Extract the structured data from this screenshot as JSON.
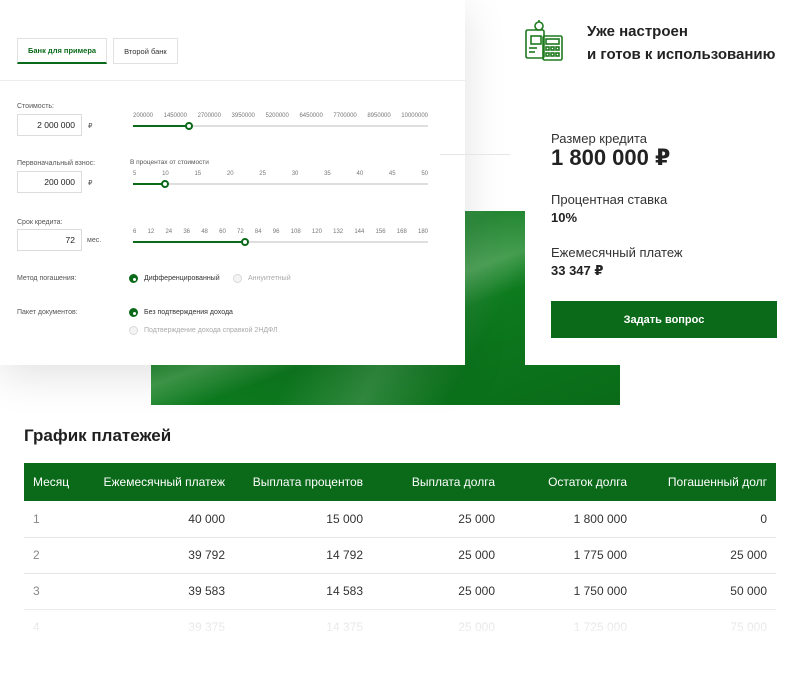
{
  "calculator": {
    "tabs": [
      "Банк для примера",
      "Второй банк"
    ],
    "cost": {
      "label": "Стоимость:",
      "value": "2 000 000",
      "unit": "₽",
      "ticks": [
        "200000",
        "1450000",
        "2700000",
        "3950000",
        "5200000",
        "6450000",
        "7700000",
        "8950000",
        "10000000"
      ],
      "level": 0.19
    },
    "down_payment": {
      "label": "Первоначальный взнос:",
      "value": "200 000",
      "unit": "₽",
      "slider_caption": "В процентах от стоимости",
      "ticks": [
        "5",
        "10",
        "15",
        "20",
        "25",
        "30",
        "35",
        "40",
        "45",
        "50"
      ],
      "level": 0.11
    },
    "term": {
      "label": "Срок кредита:",
      "value": "72",
      "unit": "мес.",
      "ticks": [
        "6",
        "12",
        "24",
        "36",
        "48",
        "60",
        "72",
        "84",
        "96",
        "108",
        "120",
        "132",
        "144",
        "156",
        "168",
        "180"
      ],
      "level": 0.38
    },
    "repayment": {
      "label": "Метод погашения:",
      "options": [
        "Дифференцированный",
        "Аннуитетный"
      ],
      "selected": 0
    },
    "documents": {
      "label": "Пакет документов:",
      "options": [
        "Без подтверждения дохода",
        "Подтверждение дохода справкой 2НДФЛ"
      ],
      "selected": 0
    }
  },
  "feature": {
    "line1": "Уже настроен",
    "line2": "и готов к использованию",
    "icon": "calculator-document-icon"
  },
  "result": {
    "loan_label": "Размер кредита",
    "loan_value": "1 800 000 ₽",
    "rate_label": "Процентная ставка",
    "rate_value": "10%",
    "payment_label": "Ежемесячный платеж",
    "payment_value": "33 347 ₽",
    "button": "Задать вопрос"
  },
  "schedule": {
    "title": "График платежей",
    "columns": [
      "Месяц",
      "Ежемесячный платеж",
      "Выплата процентов",
      "Выплата долга",
      "Остаток долга",
      "Погашенный долг"
    ],
    "rows": [
      [
        "1",
        "40 000",
        "15 000",
        "25 000",
        "1 800 000",
        "0"
      ],
      [
        "2",
        "39 792",
        "14 792",
        "25 000",
        "1 775 000",
        "25 000"
      ],
      [
        "3",
        "39 583",
        "14 583",
        "25 000",
        "1 750 000",
        "50 000"
      ],
      [
        "4",
        "39 375",
        "14 375",
        "25 000",
        "1 725 000",
        "75 000"
      ]
    ]
  },
  "colors": {
    "accent": "#0b6a1a",
    "text": "#222222",
    "muted": "#888888"
  }
}
